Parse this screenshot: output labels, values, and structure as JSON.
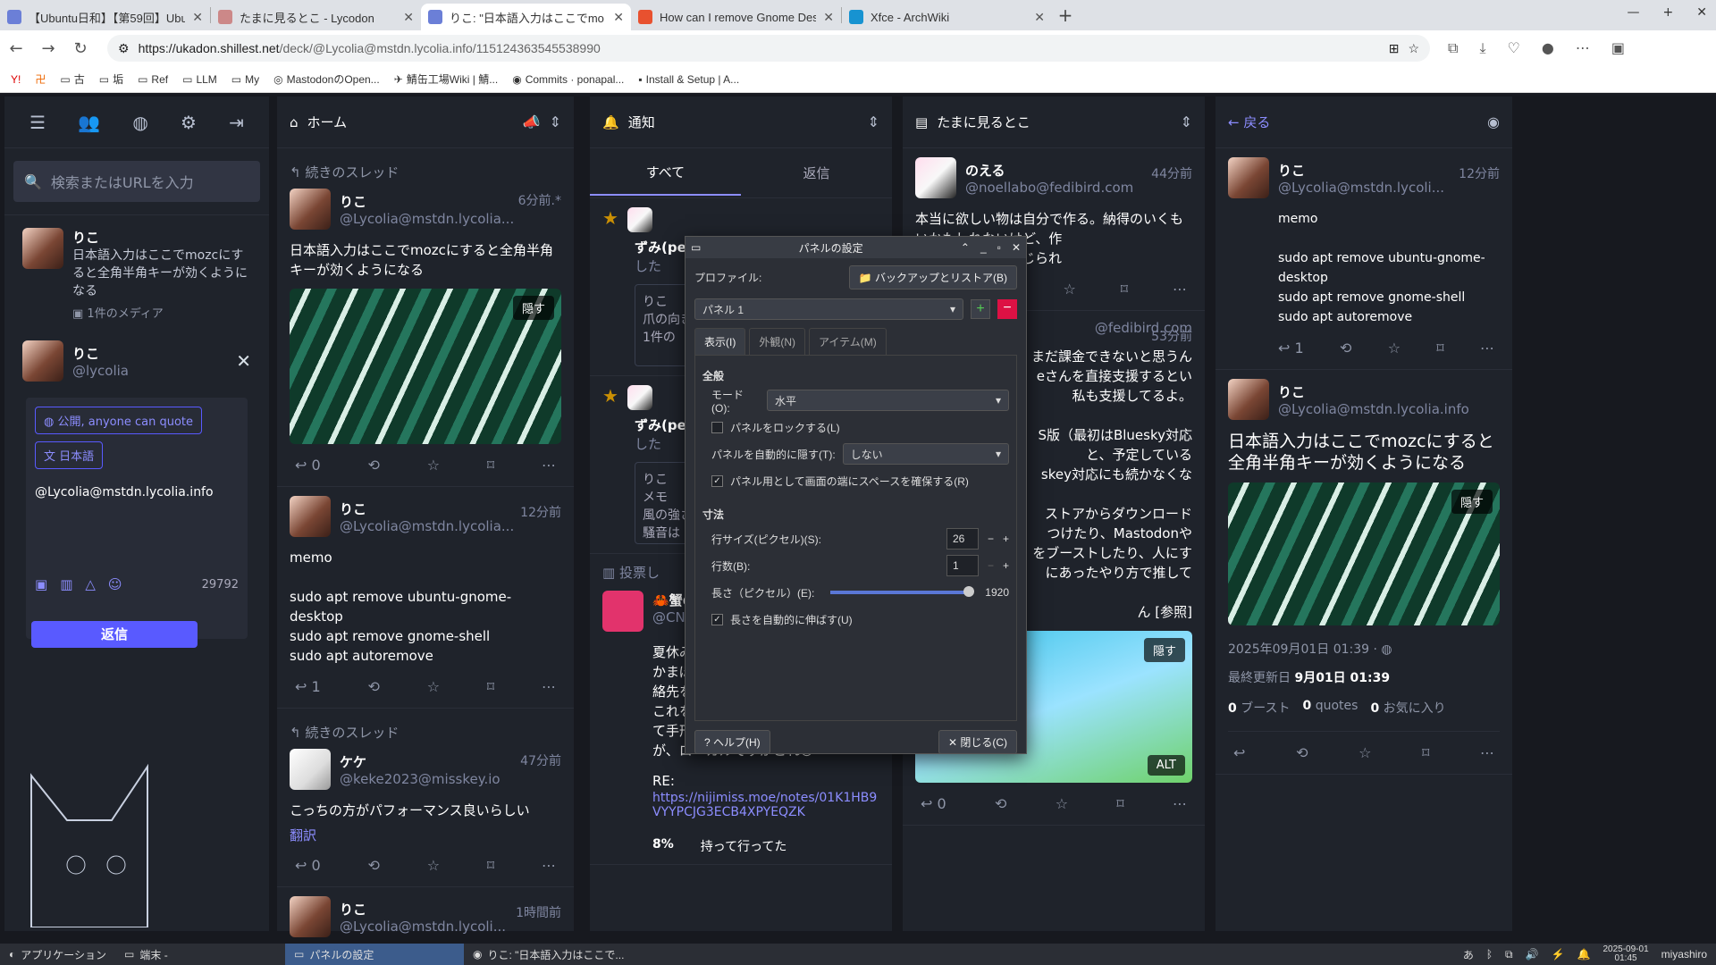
{
  "browser": {
    "tabs": [
      {
        "title": "【Ubuntu日和】【第59回】Ubu",
        "color": "#6b7fd7"
      },
      {
        "title": "たまに見るとこ - Lycodon",
        "color": "#c88"
      },
      {
        "title": "りこ: \"日本語入力はここでmo",
        "color": "#6b7fd7"
      },
      {
        "title": "How can I remove Gnome Desk",
        "color": "#e8512f"
      },
      {
        "title": "Xfce - ArchWiki",
        "color": "#1793d1"
      }
    ],
    "url_host": "https://ukadon.shillest.net",
    "url_path": "/deck/@Lycolia@mstdn.lycolia.info/115124363545538990",
    "bookmarks": [
      "古",
      "垢",
      "Ref",
      "LLM",
      "My",
      "MastodonのOpen...",
      "鯖缶工場Wiki | 鯖...",
      "Commits · ponapal...",
      "Install & Setup | A..."
    ]
  },
  "nav": {
    "search_placeholder": "検索またはURLを入力",
    "reply_to": {
      "name": "りこ",
      "body": "日本語入力はここでmozcにすると全角半角キーが効くようになる",
      "media": "1件のメディア"
    },
    "me": {
      "name": "りこ",
      "acct": "@lycolia"
    },
    "visibility": "公開, anyone can quote",
    "language": "日本語",
    "draft": "@Lycolia@mstdn.lycolia.info",
    "chars": "29792",
    "reply_btn": "返信"
  },
  "home": {
    "title": "ホーム",
    "thread": "続きのスレッド",
    "posts": [
      {
        "name": "りこ",
        "acct": "@Lycolia@mstdn.lycolia...",
        "time": "6分前.*",
        "body": "日本語入力はここでmozcにすると全角半角キーが効くようになる",
        "hide": "隠す",
        "reply": "0"
      },
      {
        "name": "りこ",
        "acct": "@Lycolia@mstdn.lycolia...",
        "time": "12分前",
        "body": "memo\n\nsudo apt remove ubuntu-gnome-desktop\nsudo apt remove gnome-shell\nsudo apt autoremove",
        "reply": "1"
      },
      {
        "name": "ケケ",
        "acct": "@keke2023@misskey.io",
        "time": "47分前",
        "body": "こっちの方がパフォーマンス良いらしい",
        "translate": "翻訳",
        "reply": "0"
      },
      {
        "name": "りこ",
        "acct": "@Lycolia@mstdn.lycoli...",
        "time": "1時間前"
      }
    ]
  },
  "notif": {
    "title": "通知",
    "tab_all": "すべて",
    "tab_reply": "返信",
    "items": [
      {
        "who": "ずみ(pers",
        "action": "した",
        "sub": "りこ",
        "text": "爪の向き",
        "media": "1件の"
      },
      {
        "who": "ずみ(pers",
        "action": "した",
        "sub": "りこ",
        "text": "メモ\n風の強さ\n騒音は"
      }
    ],
    "poll": "投票し",
    "crab": "🦀蟹の",
    "crab_acct": "@CNM",
    "body": "夏休み中\nかまぼこ\n絡先を\nこれを\nて手形としよう。\nが、ローカルですかこれ😺",
    "re": "RE:",
    "link": "https://nijimiss.moe/notes/01K1HB9VYYPCJG3ECB4XPYEQZK",
    "pct": "8%",
    "pct_label": "持って行ってた"
  },
  "tamani": {
    "title": "たまに見るとこ",
    "p1": {
      "name": "のえる",
      "acct": "@noellabo@fedibird.com",
      "time": "44分前",
      "body": "本当に欲しい物は自分で作る。納得のいくも\nいかもしれないけど、作\nひとつ手応えを感じられ"
    },
    "p2": {
      "acct": "@fedibird.com",
      "time": "53分前",
      "body": "まだ課金できないと思うん\neさんを直接支援するとい\n私も支援してるよ。\n\nS版（最初はBluesky対応\nと、予定している\nskey対応にも続かなくな\n\nストアからダウンロード\nつけたり、Mastodonや\nをブーストしたり、人にす\nにあったやり方で推して\n\nん [参照]"
    },
    "hide": "隠す",
    "alt": "ALT",
    "reply": "0"
  },
  "detail": {
    "back": "戻る",
    "p1": {
      "name": "りこ",
      "acct": "@Lycolia@mstdn.lycoli...",
      "time": "12分前",
      "body": "memo\n\nsudo apt remove ubuntu-gnome-desktop\nsudo apt remove gnome-shell\nsudo apt autoremove",
      "reply": "1"
    },
    "p2": {
      "name": "りこ",
      "acct": "@Lycolia@mstdn.lycolia.info",
      "body": "日本語入力はここでmozcにすると全角半角キーが効くようになる",
      "hide": "隠す",
      "date": "2025年09月01日 01:39",
      "updated_label": "最終更新日",
      "updated": "9月01日 01:39",
      "boost": "0",
      "boost_l": "ブースト",
      "quotes": "0",
      "quotes_l": "quotes",
      "fav": "0",
      "fav_l": "お気に入り"
    }
  },
  "dialog": {
    "title": "パネルの設定",
    "profile_label": "プロファイル:",
    "backup": "バックアップとリストア(B)",
    "panel": "パネル 1",
    "tabs": [
      "表示(I)",
      "外観(N)",
      "アイテム(M)"
    ],
    "general": "全般",
    "mode_label": "モード(O):",
    "mode": "水平",
    "lock": "パネルをロックする(L)",
    "autohide_label": "パネルを自動的に隠す(T):",
    "autohide": "しない",
    "reserve": "パネル用として画面の端にスペースを確保する(R)",
    "size_sec": "寸法",
    "row_size_label": "行サイズ(ピクセル)(S):",
    "row_size": "26",
    "rows_label": "行数(B):",
    "rows": "1",
    "length_label": "長さ（ピクセル）(E):",
    "length": "1920",
    "autolen": "長さを自動的に伸ばす(U)",
    "help": "ヘルプ(H)",
    "close": "閉じる(C)"
  },
  "taskbar": {
    "apps": "アプリケーション",
    "term": "端末 -",
    "panel": "パネルの設定",
    "browser": "りこ: \"日本語入力はここで...",
    "ime": "あ",
    "date": "2025-09-01",
    "time": "01:45",
    "user": "miyashiro"
  }
}
